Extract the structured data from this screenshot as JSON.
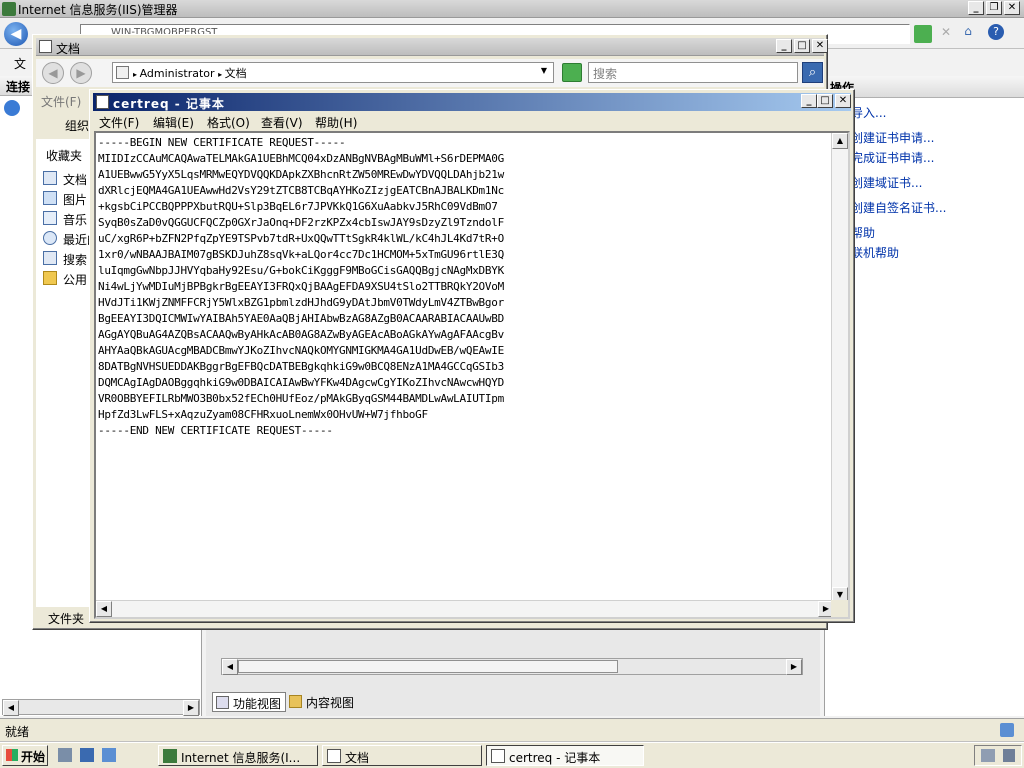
{
  "iis": {
    "title": "Internet 信息服务(IIS)管理器",
    "address_fragment": "WIN-TBGMQBPERGST",
    "left_header": "连接",
    "left_menu_char": "文",
    "right_header": "操作",
    "actions": [
      "导入...",
      "创建证书申请...",
      "完成证书申请...",
      "创建域证书...",
      "创建自签名证书...",
      "帮助",
      "联机帮助"
    ],
    "view_tabs": [
      "功能视图",
      "内容视图"
    ],
    "status": "就绪"
  },
  "explorer": {
    "title": "文档",
    "breadcrumb": [
      "Administrator",
      "文档"
    ],
    "search_placeholder": "搜索",
    "menu_file": "文件(F)",
    "toolbar_organize": "组织",
    "favorites_header": "收藏夹",
    "sidebar": [
      "文档",
      "图片",
      "音乐",
      "最近的",
      "搜索",
      "公用"
    ],
    "status": "文件夹"
  },
  "notepad": {
    "title": "certreq - 记事本",
    "menu": [
      "文件(F)",
      "编辑(E)",
      "格式(O)",
      "查看(V)",
      "帮助(H)"
    ],
    "content": "-----BEGIN NEW CERTIFICATE REQUEST-----\nMIIDIzCCAuMCAQAwaTELMAkGA1UEBhMCQ04xDzANBgNVBAgMBuWMl+S6rDEPMA0G\nA1UEBwwG5YyX5LqsMRMwEQYDVQQKDApkZXBhcnRtZW50MREwDwYDVQQLDAhjb21w\ndXRlcjEQMA4GA1UEAwwHd2VsY29tZTCB8TCBqAYHKoZIzjgEATCBnAJBALKDm1Nc\n+kgsbCiPCCBQPPPXbutRQU+Slp3BqEL6r7JPVKkQ1G6XuAabkvJ5RhC09VdBmO7\nSyqB0sZaD0vQGGUCFQCZp0GXrJaOnq+DF2rzKPZx4cbIswJAY9sDzyZl9TzndolF\nuC/xgR6P+bZFN2PfqZpYE9TSPvb7tdR+UxQQwTTtSgkR4klWL/kC4hJL4Kd7tR+O\n1xr0/wNBAAJBAIM07gBSKDJuhZ8sqVk+aLQor4cc7Dc1HCMOM+5xTmGU96rtlE3Q\nluIqmgGwNbpJJHVYqbaHy92Esu/G+bokCiKgggF9MBoGCisGAQQBgjcNAgMxDBYK\nNi4wLjYwMDIuMjBPBgkrBgEEAYI3FRQxQjBAAgEFDA9XSU4tSlo2TTBRQkY2OVoM\nHVdJTi1KWjZNMFFCRjY5WlxBZG1pbmlzdHJhdG9yDAtJbmV0TWdyLmV4ZTBwBgor\nBgEEAYI3DQICMWIwYAIBAh5YAE0AaQBjAHIAbwBzAG8AZgB0ACAARABIACAAUwBD\nAGgAYQBuAG4AZQBsACAAQwByAHkAcAB0AG8AZwByAGEAcABoAGkAYwAgAFAAcgBv\nAHYAaQBkAGUAcgMBADCBmwYJKoZIhvcNAQkOMYGNMIGKMA4GA1UdDwEB/wQEAwIE\n8DATBgNVHSUEDDAKBggrBgEFBQcDATBEBgkqhkiG9w0BCQ8ENzA1MA4GCCqGSIb3\nDQMCAgIAgDAOBggqhkiG9w0DBAICAIAwBwYFKw4DAgcwCgYIKoZIhvcNAwcwHQYD\nVR0OBBYEFILRbMWO3B0bx52fECh0HUfEoz/pMAkGByqGSM44BAMDLwAwLAIUTIpm\nHpfZd3LwFLS+xAqzuZyam08CFHRxuoLnemWx0OHvUW+W7jfhboGF\n-----END NEW CERTIFICATE REQUEST-----"
  },
  "taskbar": {
    "start": "开始",
    "tasks": [
      "Internet 信息服务(I...",
      "文档",
      "certreq - 记事本"
    ]
  },
  "colors": {
    "active_title_start": "#0a246a",
    "active_title_end": "#a6caf0",
    "link": "#0033aa"
  }
}
